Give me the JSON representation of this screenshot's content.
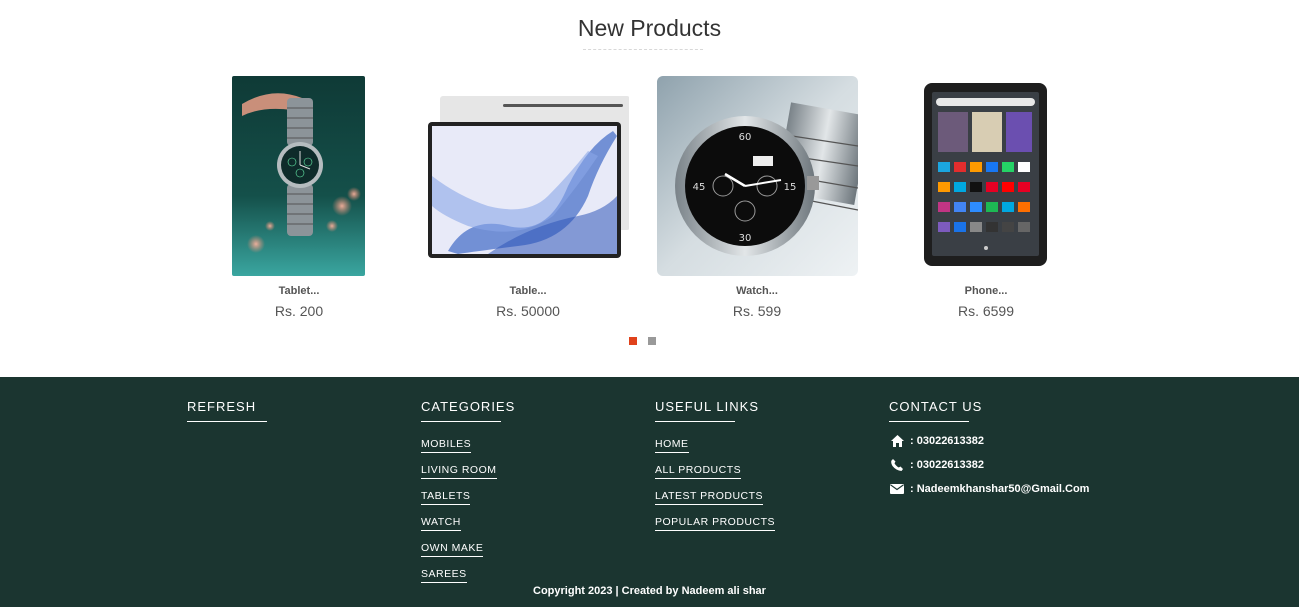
{
  "section": {
    "title": "New Products"
  },
  "products": [
    {
      "name": "Tablet...",
      "price": "Rs. 200"
    },
    {
      "name": "Table...",
      "price": "Rs. 50000"
    },
    {
      "name": "Watch...",
      "price": "Rs. 599"
    },
    {
      "name": "Phone...",
      "price": "Rs. 6599"
    }
  ],
  "carousel": {
    "active_dot_color": "#e0421b",
    "dot_color": "#999999"
  },
  "footer": {
    "background": "#1b3530",
    "refresh": {
      "heading": "REFRESH"
    },
    "categories": {
      "heading": "CATEGORIES",
      "links": [
        "MOBILES",
        "LIVING ROOM",
        "TABLETS",
        "WATCH",
        "OWN MAKE",
        "SAREES"
      ]
    },
    "useful_links": {
      "heading": "USEFUL LINKS",
      "links": [
        "HOME",
        "ALL PRODUCTS",
        "LATEST PRODUCTS",
        "POPULAR PRODUCTS"
      ]
    },
    "contact": {
      "heading": "CONTACT US",
      "address": ": 03022613382",
      "phone": ": 03022613382",
      "email": ": Nadeemkhanshar50@Gmail.Com",
      "icons": [
        "home-icon",
        "phone-icon",
        "envelope-icon"
      ]
    },
    "copyright": "Copyright 2023 | Created by Nadeem ali shar"
  }
}
